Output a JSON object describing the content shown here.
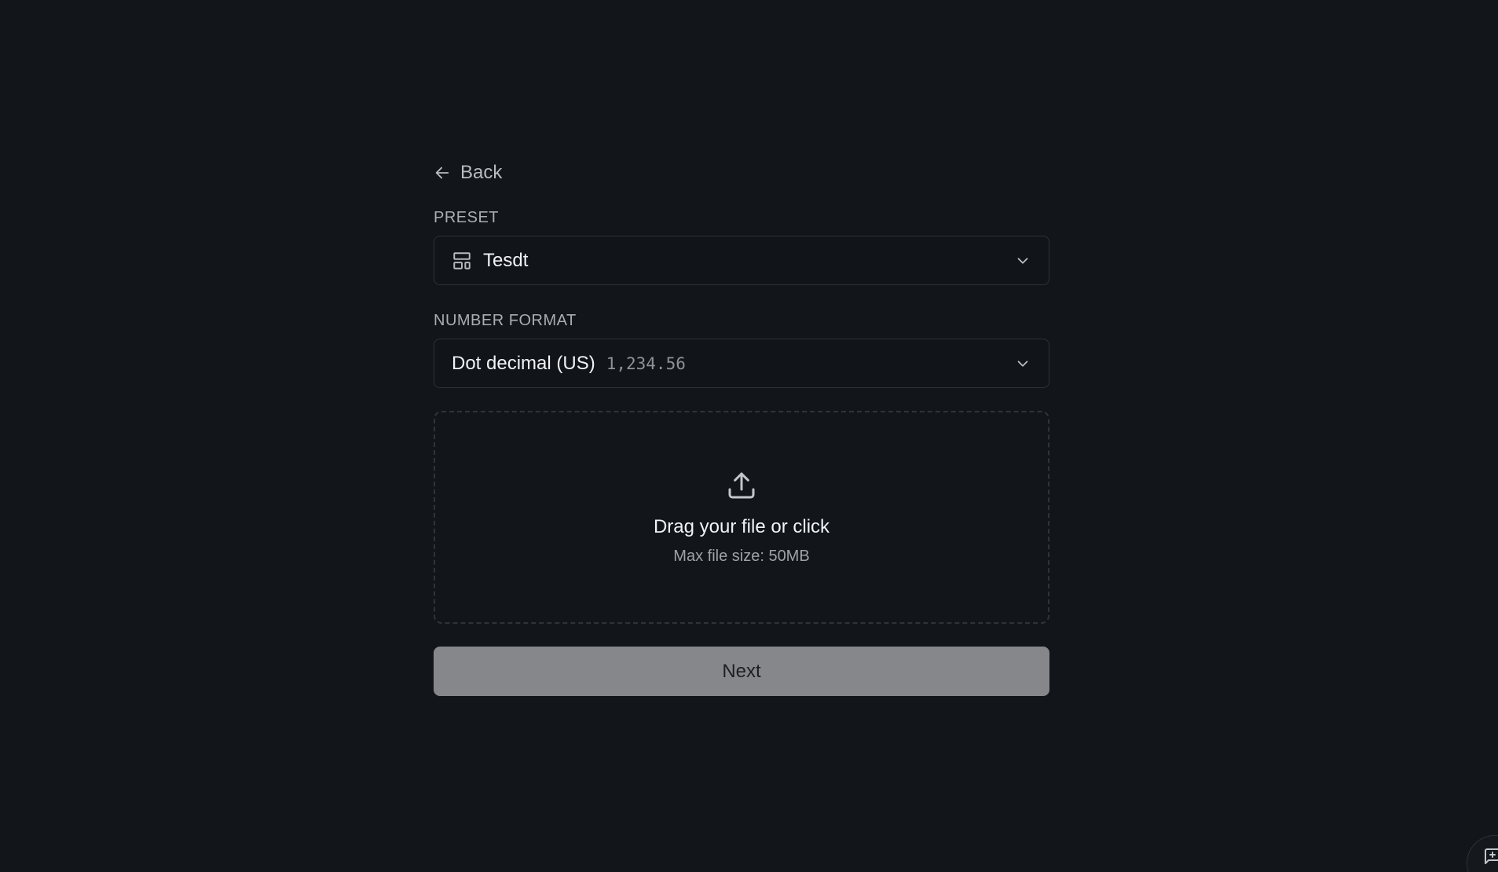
{
  "back": {
    "label": "Back"
  },
  "preset": {
    "label": "PRESET",
    "value": "Tesdt"
  },
  "number_format": {
    "label": "NUMBER FORMAT",
    "value": "Dot decimal (US)",
    "example": "1,234.56"
  },
  "dropzone": {
    "title": "Drag your file or click",
    "subtitle": "Max file size: 50MB"
  },
  "next_button": {
    "label": "Next",
    "enabled": false
  },
  "colors": {
    "background": "#121519",
    "border": "#2d3239",
    "button_disabled": "#85878a"
  }
}
